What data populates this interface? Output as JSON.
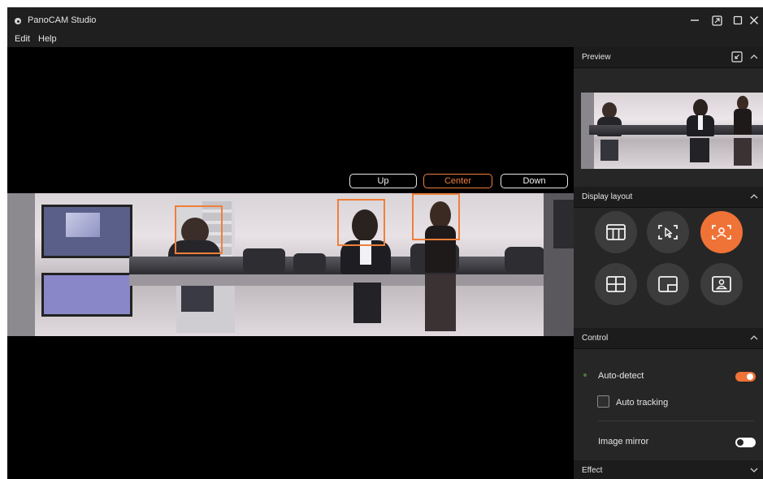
{
  "app": {
    "title": "PanoCAM Studio",
    "accent_color": "#ef7236"
  },
  "window_controls": {
    "icons": [
      "minimize-icon",
      "compact-mode-icon",
      "maximize-icon",
      "close-icon"
    ]
  },
  "menu": {
    "items": [
      {
        "label": "Edit"
      },
      {
        "label": "Help"
      }
    ]
  },
  "view_controls": {
    "buttons": [
      {
        "label": "Up",
        "active": false
      },
      {
        "label": "Center",
        "active": true
      },
      {
        "label": "Down",
        "active": false
      }
    ]
  },
  "panorama": {
    "detected_faces": 3
  },
  "sidebar": {
    "preview": {
      "title": "Preview",
      "icons": [
        "exit-fullscreen-icon",
        "chevron-up-icon"
      ]
    },
    "display_layout": {
      "title": "Display layout",
      "options": [
        {
          "icon": "single-view-layout-icon",
          "active": false
        },
        {
          "icon": "manual-select-layout-icon",
          "active": false
        },
        {
          "icon": "auto-framing-layout-icon",
          "active": true
        },
        {
          "icon": "grid-layout-icon",
          "active": false
        },
        {
          "icon": "picture-in-picture-layout-icon",
          "active": false
        },
        {
          "icon": "speaker-layout-icon",
          "active": false
        }
      ]
    },
    "control": {
      "title": "Control",
      "auto_detect_label": "Auto-detect",
      "auto_detect_on": true,
      "auto_tracking_label": "Auto tracking",
      "auto_tracking_checked": false,
      "image_mirror_label": "Image mirror",
      "image_mirror_on": false
    },
    "effect": {
      "title": "Effect"
    }
  }
}
